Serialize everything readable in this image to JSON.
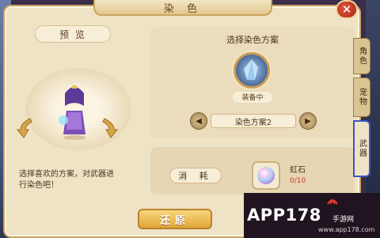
{
  "window": {
    "title": "染 色",
    "close_label": "✕"
  },
  "preview": {
    "label": "预 览",
    "description": "选择喜欢的方案，对武器进行染色吧！"
  },
  "scheme": {
    "title": "选择染色方案",
    "equipped_label": "装备中",
    "current_scheme": "染色方案2",
    "prev_label": "◀",
    "next_label": "▶"
  },
  "cost": {
    "label": "消 耗",
    "material_name": "虹石",
    "material_count": "0/10"
  },
  "actions": {
    "restore_label": "还原"
  },
  "side_tabs": {
    "role": "角色",
    "pet": "宠物",
    "weapon": "武器"
  },
  "watermark": {
    "main": "APP178",
    "sub": "手游网",
    "url": "www.app178.com"
  },
  "colors": {
    "panel_bg": "#efe3c6",
    "gold_border": "#c9a45e",
    "restore_button": "#e2a63a",
    "count_red": "#d2362a",
    "selected_tab_outline": "#3a55c4"
  }
}
